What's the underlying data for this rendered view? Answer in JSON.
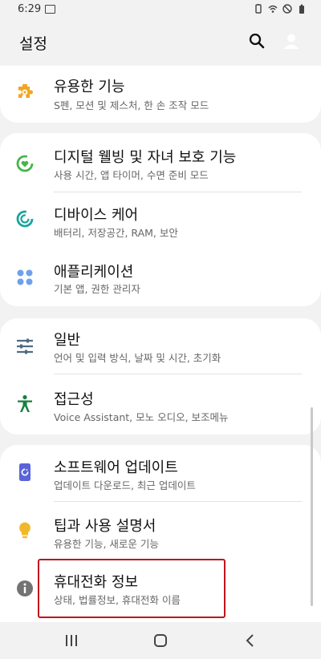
{
  "status": {
    "time": "6:29"
  },
  "header": {
    "title": "설정"
  },
  "cards": [
    {
      "items": [
        {
          "label": "유용한 기능",
          "sub": "S펜, 모션 및 제스처, 한 손 조작 모드"
        }
      ]
    },
    {
      "items": [
        {
          "label": "디지털 웰빙 및 자녀 보호 기능",
          "sub": "사용 시간, 앱 타이머, 수면 준비 모드"
        },
        {
          "label": "디바이스 케어",
          "sub": "배터리, 저장공간, RAM, 보안"
        },
        {
          "label": "애플리케이션",
          "sub": "기본 앱, 권한 관리자"
        }
      ]
    },
    {
      "items": [
        {
          "label": "일반",
          "sub": "언어 및 입력 방식, 날짜 및 시간, 초기화"
        },
        {
          "label": "접근성",
          "sub": "Voice Assistant, 모노 오디오, 보조메뉴"
        }
      ]
    },
    {
      "items": [
        {
          "label": "소프트웨어 업데이트",
          "sub": "업데이트 다운로드, 최근 업데이트"
        },
        {
          "label": "팁과 사용 설명서",
          "sub": "유용한 기능, 새로운 기능"
        },
        {
          "label": "휴대전화 정보",
          "sub": "상태, 법률정보, 휴대전화 이름"
        }
      ]
    }
  ],
  "icons": {
    "useful": "puzzle-icon",
    "wellbeing": "heart-ring-icon",
    "device_care": "refresh-ring-icon",
    "apps": "apps-grid-icon",
    "general": "sliders-icon",
    "accessibility": "accessibility-person-icon",
    "software_update": "update-icon",
    "tips": "lightbulb-icon",
    "about": "info-icon"
  },
  "colors": {
    "background": "#f2f2f2",
    "card": "#ffffff",
    "accent": "#1a7be6",
    "highlight": "#c0151d",
    "orange": "#f3a521",
    "green": "#47b549",
    "teal": "#18a59a",
    "blue_light": "#6ea1ea",
    "slate": "#4d6c85",
    "dark_green": "#16813d",
    "indigo": "#5a63d8",
    "yellow": "#f2b82b",
    "gray": "#737373"
  }
}
